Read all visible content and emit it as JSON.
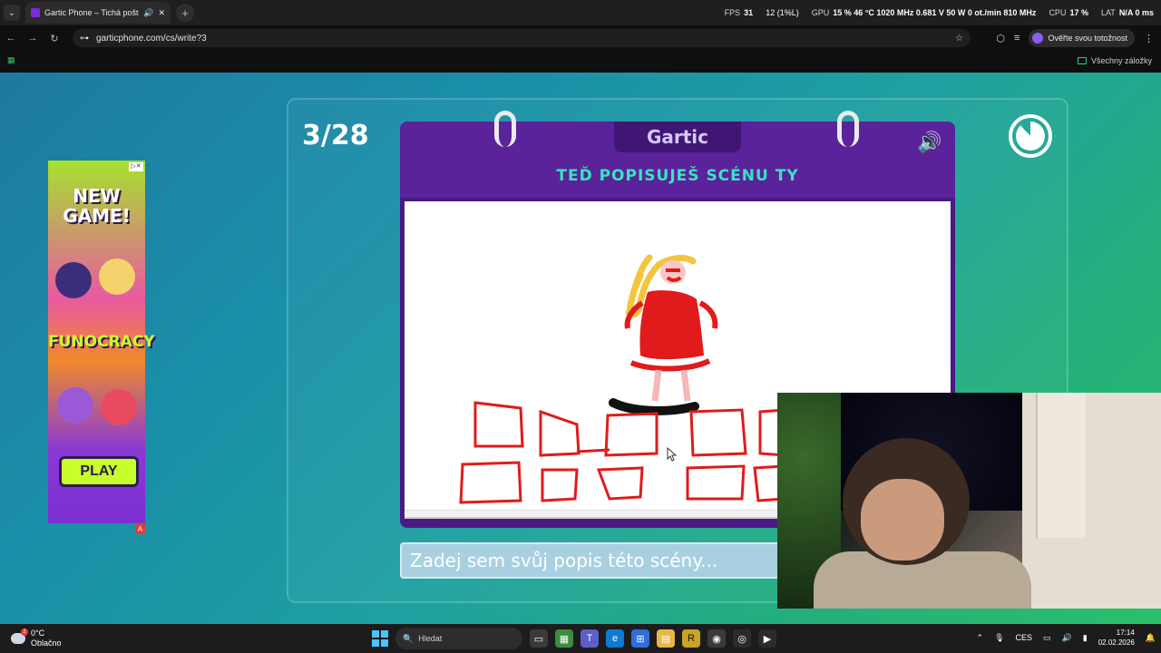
{
  "browser": {
    "tab_title": "Gartic Phone – Tichá pošta",
    "url": "garticphone.com/cs/write?3",
    "profile_label": "Ověřte svou totožnost",
    "bookmarks_label": "Všechny záložky"
  },
  "overlay_stats": {
    "fps_label": "FPS",
    "fps_value": "31",
    "fps_extra": "12 (1%L)",
    "gpu_label": "GPU",
    "gpu_value": "15 % 46 °C 1020 MHz 0.681 V 50 W 0 ot./min 810 MHz",
    "cpu_label": "CPU",
    "cpu_value": "17 %",
    "lat_label": "LAT",
    "lat_value": "N/A 0 ms"
  },
  "game": {
    "counter": "3/28",
    "logo": "Gartic",
    "heading": "TEĎ POPISUJEŠ SCÉNU TY",
    "input_placeholder": "Zadej sem svůj popis této scény..."
  },
  "ad": {
    "headline_1": "NEW",
    "headline_2": "GAME!",
    "brand": "FUNOCRACY",
    "cta": "PLAY",
    "ad_mark": "A"
  },
  "taskbar": {
    "temperature": "0°C",
    "weather": "Oblačno",
    "weather_badge": "2",
    "search": "Hledat",
    "language": "CES",
    "time": "17:14",
    "date": "02.02.2026"
  },
  "colors": {
    "accent_teal": "#38e3c1",
    "book_purple": "#5a239a",
    "drawing_red": "#e11b1b"
  }
}
